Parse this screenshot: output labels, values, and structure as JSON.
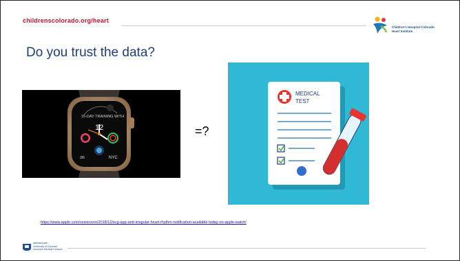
{
  "header": {
    "site_url": "childrenscolorado.org/heart",
    "logo_line1": "Children's Hospital Colorado",
    "logo_line2": "Heart Institute"
  },
  "slide": {
    "title": "Do you trust the data?",
    "compare_label": "=?"
  },
  "watch": {
    "arc_text": "15-DAY TRAINING WITH",
    "time": "12",
    "location": "NYC"
  },
  "medical_card": {
    "line1": "MEDICAL",
    "line2": "TEST"
  },
  "footer": {
    "link": "https://www.apple.com/newsroom/2018/12/ecg-app-and-irregular-heart-rhythm-notification-available-today-on-apple-watch/",
    "affil_line1": "Affiliated with",
    "affil_line2": "University of Colorado",
    "affil_line3": "Anschutz Medical Campus"
  },
  "colors": {
    "brand_red": "#c8102e",
    "title_blue": "#1f3d7a",
    "image_bg": "#2fb9d4"
  }
}
